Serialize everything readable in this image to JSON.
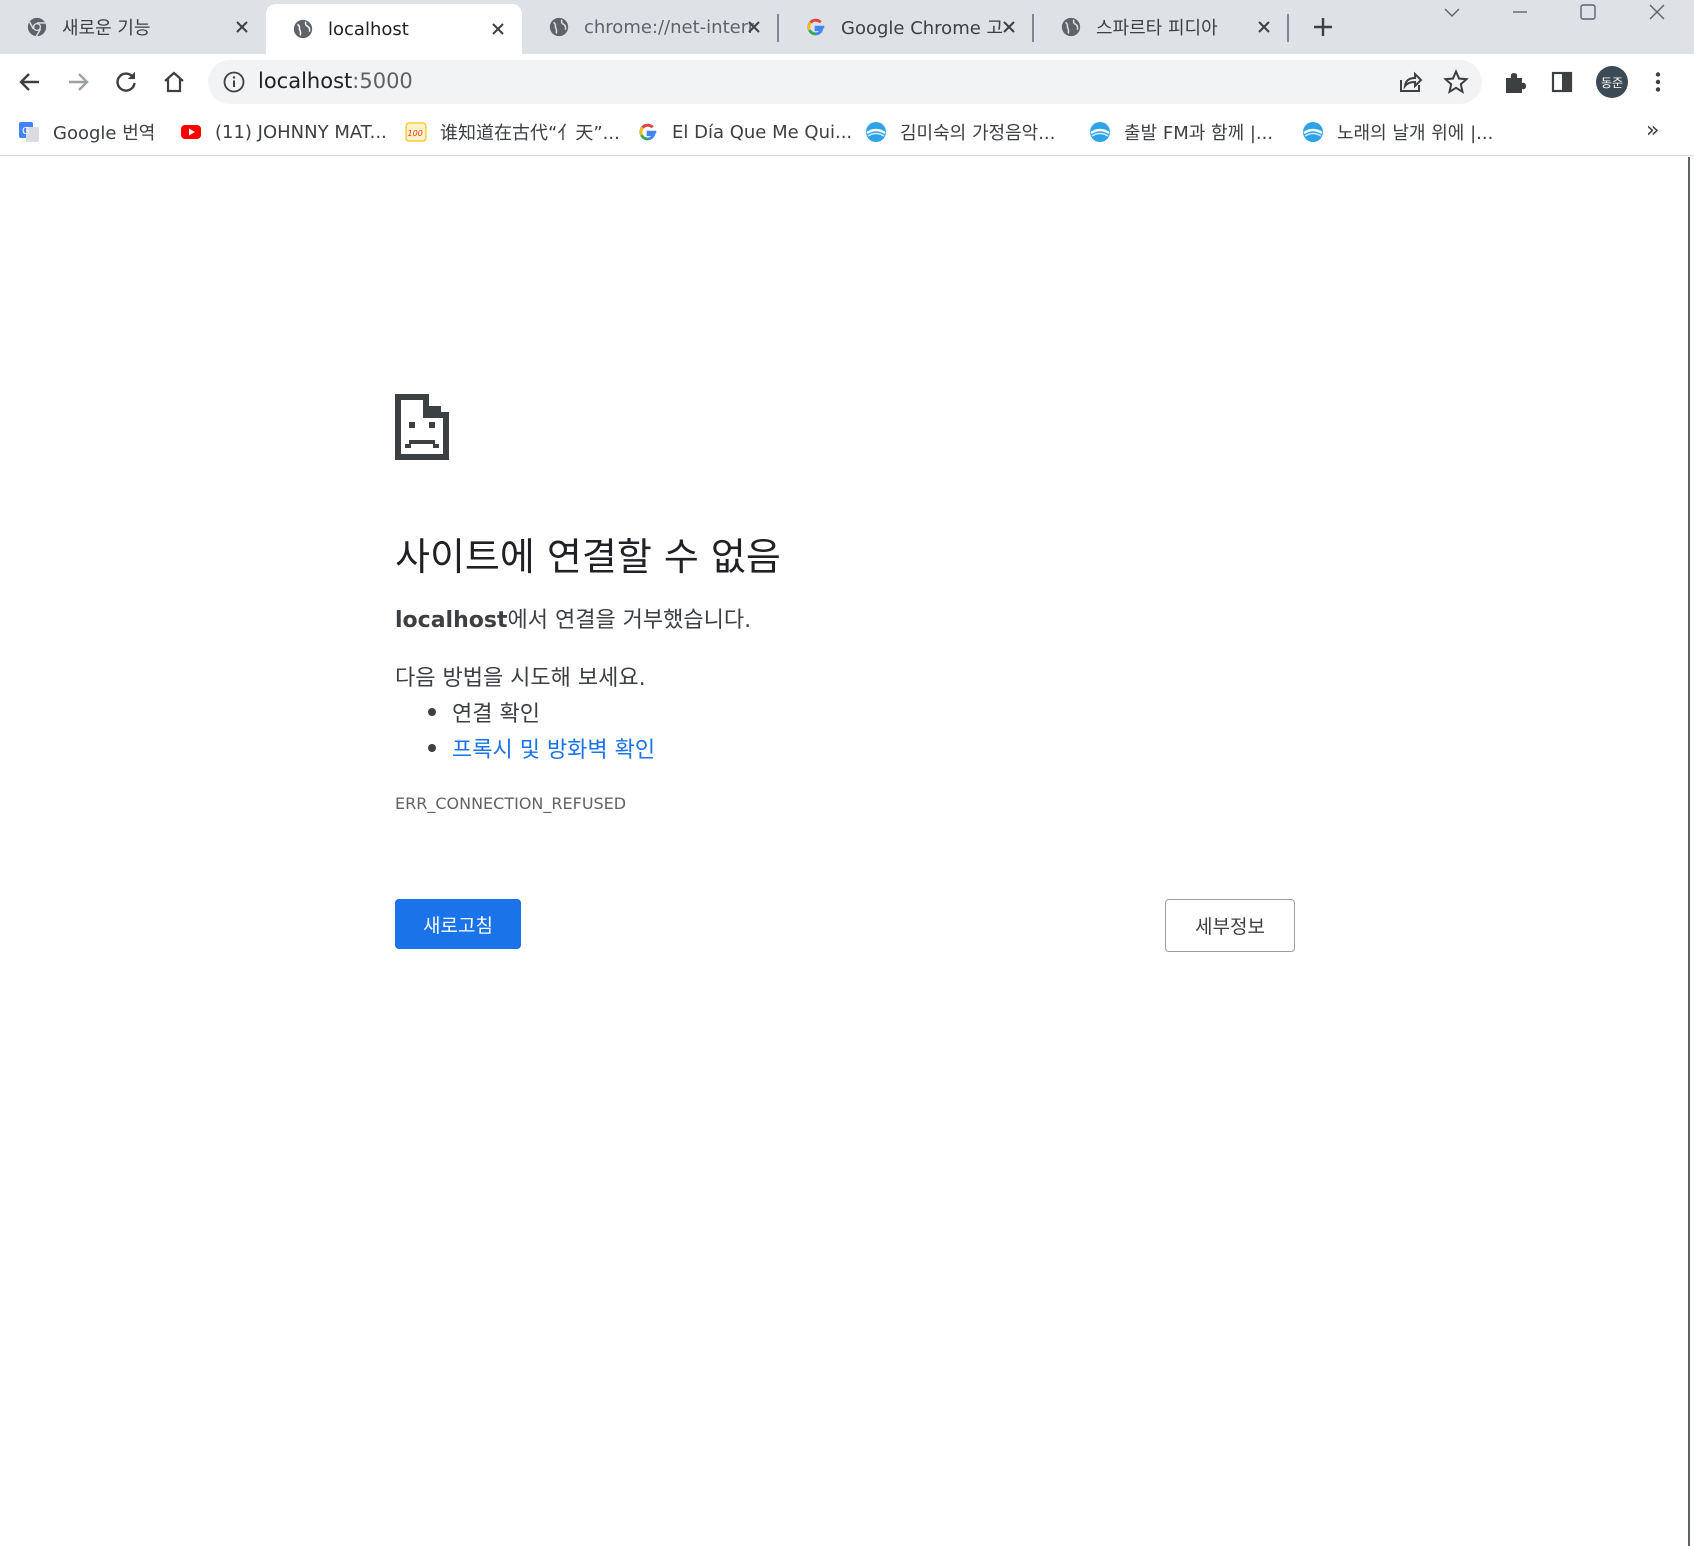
{
  "window": {
    "tabs": [
      {
        "label": "새로운 기능",
        "icon": "chrome-logo-icon",
        "active": false
      },
      {
        "label": "localhost",
        "icon": "globe-icon",
        "active": true
      },
      {
        "label": "chrome://net-intern",
        "icon": "globe-icon",
        "active": false
      },
      {
        "label": "Google Chrome 고",
        "icon": "google-g-icon",
        "active": false
      },
      {
        "label": "스파르타 피디아",
        "icon": "globe-icon",
        "active": false
      }
    ],
    "controls": [
      "tab-search-icon",
      "minimize-icon",
      "maximize-icon",
      "close-icon"
    ]
  },
  "toolbar": {
    "url_host": "localhost",
    "url_port": ":5000",
    "profile_initials": "동준"
  },
  "bookmarks": [
    {
      "label": "Google 번역",
      "icon": "google-translate-icon"
    },
    {
      "label": "(11) JOHNNY MAT...",
      "icon": "youtube-icon"
    },
    {
      "label": "谁知道在古代“亻天”...",
      "icon": "baidu-icon"
    },
    {
      "label": "El Día Que Me Qui...",
      "icon": "google-g-icon"
    },
    {
      "label": "김미숙의 가정음악...",
      "icon": "radio-icon"
    },
    {
      "label": "출발 FM과 함께 |...",
      "icon": "radio-icon"
    },
    {
      "label": "노래의 날개 위에 |...",
      "icon": "radio-icon"
    }
  ],
  "bookmarks_more": "»",
  "error": {
    "title": "사이트에 연결할 수 없음",
    "host_bold": "localhost",
    "message_rest": "에서 연결을 거부했습니다.",
    "try_label": "다음 방법을 시도해 보세요.",
    "suggestions": [
      "연결 확인",
      "프록시 및 방화벽 확인"
    ],
    "code": "ERR_CONNECTION_REFUSED",
    "reload_button": "새로고침",
    "details_button": "세부정보"
  },
  "colors": {
    "accent": "#1a73e8",
    "tabstrip": "#dee1e6",
    "omnibox": "#f1f3f4"
  }
}
